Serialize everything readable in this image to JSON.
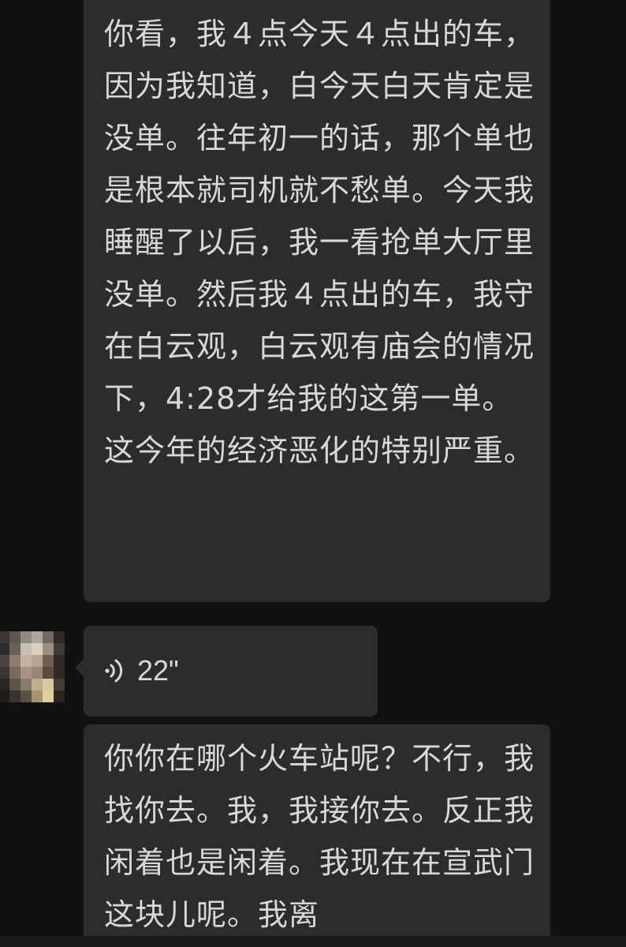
{
  "messages": [
    {
      "type": "text",
      "text": "你看，我４点今天４点出的车，因为我知道，白今天白天肯定是没单。往年初一的话，那个单也是根本就司机就不愁单。今天我睡醒了以后，我一看抢单大厅里没单。然后我４点出的车，我守在白云观，白云观有庙会的情况下，4:28才给我的这第一单。这今年的经济恶化的特别严重。"
    },
    {
      "type": "voice",
      "duration": "22\"",
      "icon": "voice-wave-icon"
    },
    {
      "type": "text",
      "text": "你你在哪个火车站呢？不行，我找你去。我，我接你去。反正我闲着也是闲着。我现在在宣武门这块儿呢。我离"
    }
  ],
  "colors": {
    "background": "#111111",
    "bubble": "#2c2c2c",
    "text": "#d8d8d8"
  }
}
